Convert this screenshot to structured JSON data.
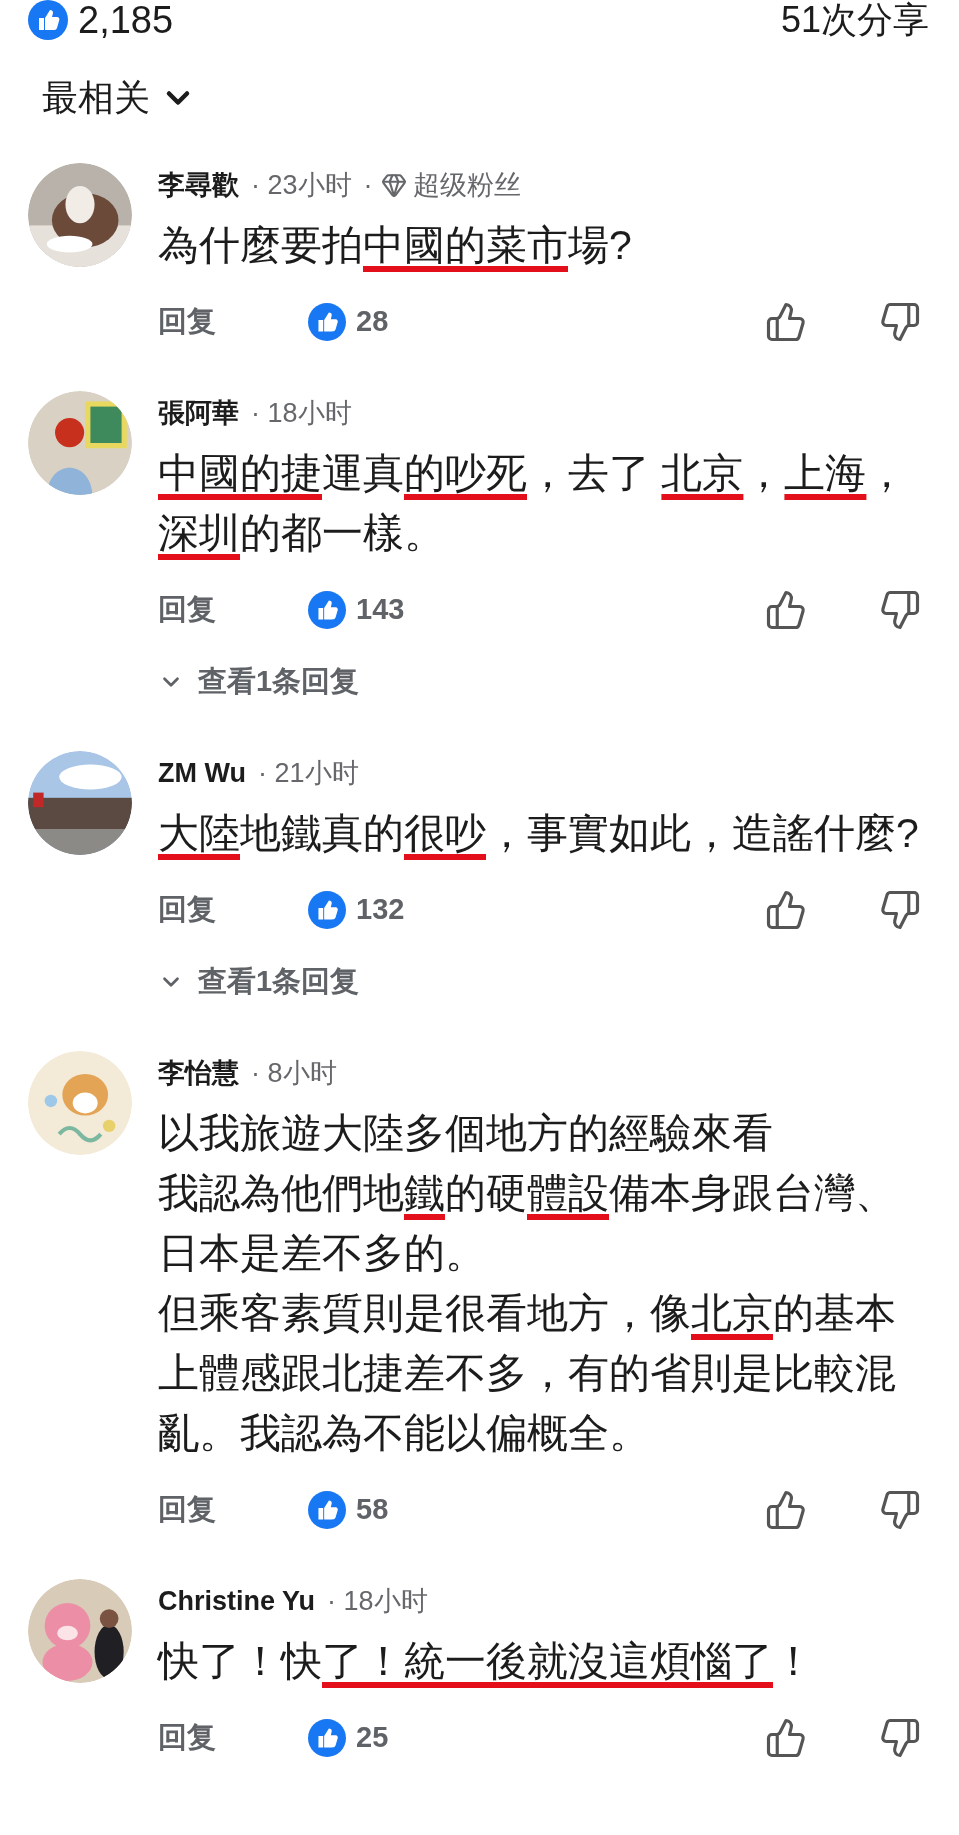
{
  "header": {
    "reactions": "2,185",
    "shares": "51次分享"
  },
  "sort": {
    "label": "最相关"
  },
  "comments": [
    {
      "author": "李尋歡",
      "time": "· 23小时",
      "badge": {
        "separator": "·",
        "label": "超级粉丝"
      },
      "body": [
        [
          {
            "text": "為什麼要拍",
            "struck": false
          },
          {
            "text": "中國的菜市",
            "struck": true
          },
          {
            "text": "場?",
            "struck": false
          }
        ]
      ],
      "reply": "回复",
      "likes": "28"
    },
    {
      "author": "張阿華",
      "time": "· 18小时",
      "body": [
        [
          {
            "text": "中國的捷",
            "struck": true
          },
          {
            "text": "運真",
            "struck": false
          },
          {
            "text": "的吵死",
            "struck": true
          },
          {
            "text": "，去了 ",
            "struck": false
          },
          {
            "text": "北京",
            "struck": true
          },
          {
            "text": "，",
            "struck": false
          },
          {
            "text": "上海",
            "struck": true
          },
          {
            "text": "，",
            "struck": false
          },
          {
            "text": "深圳",
            "struck": true
          },
          {
            "text": "的都一樣。",
            "struck": false
          }
        ]
      ],
      "reply": "回复",
      "likes": "143",
      "replies": "查看1条回复"
    },
    {
      "author": "ZM Wu",
      "time": "· 21小时",
      "body": [
        [
          {
            "text": "大陸",
            "struck": true
          },
          {
            "text": "地鐵真的",
            "struck": false
          },
          {
            "text": "很吵",
            "struck": true
          },
          {
            "text": "，事實如此，造謠什麼?",
            "struck": false
          }
        ]
      ],
      "reply": "回复",
      "likes": "132",
      "replies": "查看1条回复"
    },
    {
      "author": "李怡慧",
      "time": "· 8小时",
      "body": [
        [
          {
            "text": "以我旅遊大陸多個地方的經驗來看",
            "struck": false
          }
        ],
        [
          {
            "text": "我認為他們地",
            "struck": false
          },
          {
            "text": "鐵",
            "struck": true
          },
          {
            "text": "的硬",
            "struck": false
          },
          {
            "text": "體設",
            "struck": true
          },
          {
            "text": "備本身跟台灣、日本是差不多的。",
            "struck": false
          }
        ],
        [
          {
            "text": "但乘客素質則是很看地方，像",
            "struck": false
          },
          {
            "text": "北京",
            "struck": true
          },
          {
            "text": "的基本上體感跟北捷差不多，有的省則是比較混亂。我認為不能以偏概全。",
            "struck": false
          }
        ]
      ],
      "reply": "回复",
      "likes": "58"
    },
    {
      "author": "Christine Yu",
      "time": "· 18小时",
      "body": [
        [
          {
            "text": "快了！快",
            "struck": false
          },
          {
            "text": "了！統一後就沒這煩惱了",
            "struck": true
          },
          {
            "text": "！",
            "struck": false
          }
        ]
      ],
      "reply": "回复",
      "likes": "25"
    }
  ]
}
